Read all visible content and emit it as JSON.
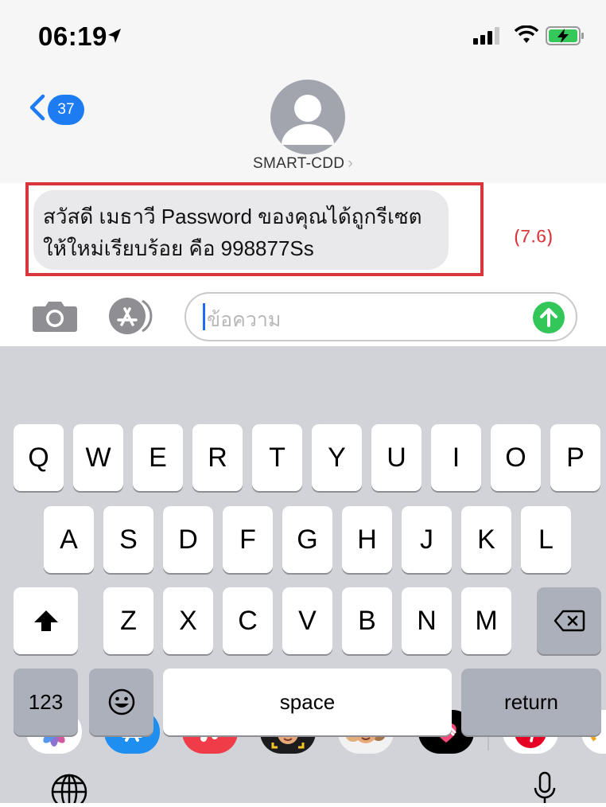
{
  "status_bar": {
    "time": "06:19",
    "icons": [
      "location-arrow-icon",
      "cellular-signal-icon",
      "wifi-icon",
      "battery-charging-icon"
    ]
  },
  "header": {
    "back_count": "37",
    "contact_name": "SMART-CDD",
    "chevron": "›"
  },
  "message": {
    "lines": [
      "สวัสดี เมธาวี Password ของคุณได้ถูกรีเซต",
      "ให้ใหม่เรียบร้อย คือ 998877Ss"
    ]
  },
  "annotation": {
    "label": "(7.6)",
    "color": "#d9363b"
  },
  "composer": {
    "placeholder": "ข้อความ",
    "send_color": "#33c659"
  },
  "app_strip": [
    "photos-app-icon",
    "app-store-app-icon",
    "music-app-icon",
    "memoji-app-icon",
    "animoji-stickers-app-icon",
    "digital-touch-app-icon",
    "pinterest-app-icon",
    "partial-app-icon"
  ],
  "keyboard": {
    "row1": [
      "Q",
      "W",
      "E",
      "R",
      "T",
      "Y",
      "U",
      "I",
      "O",
      "P"
    ],
    "row2": [
      "A",
      "S",
      "D",
      "F",
      "G",
      "H",
      "J",
      "K",
      "L"
    ],
    "row3": [
      "Z",
      "X",
      "C",
      "V",
      "B",
      "N",
      "M"
    ],
    "numbers_label": "123",
    "space_label": "space",
    "return_label": "return"
  },
  "colors": {
    "accent": "#1e7cf2",
    "keyboard_bg": "#d1d3d9"
  }
}
